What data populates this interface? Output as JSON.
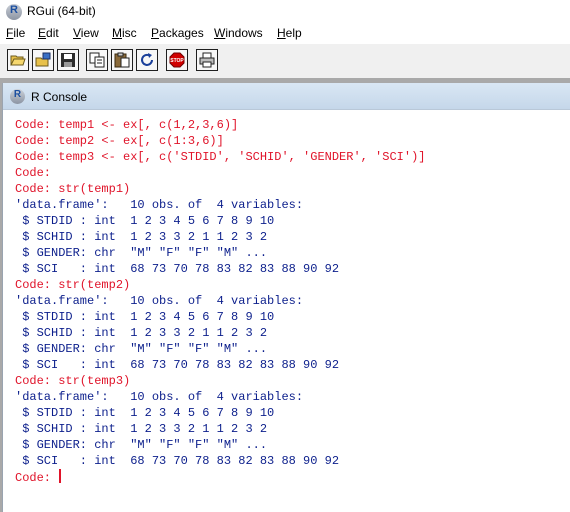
{
  "window": {
    "title": "RGui (64-bit)"
  },
  "menu": {
    "items": [
      {
        "underline": "F",
        "rest": "ile"
      },
      {
        "underline": "E",
        "rest": "dit"
      },
      {
        "underline": "V",
        "rest": "iew"
      },
      {
        "underline": "M",
        "rest": "isc"
      },
      {
        "underline": "P",
        "rest": "ackages"
      },
      {
        "underline": "W",
        "rest": "indows"
      },
      {
        "underline": "H",
        "rest": "elp"
      }
    ]
  },
  "toolbar": {
    "buttons": [
      {
        "icon": "open-folder-icon"
      },
      {
        "icon": "load-workspace-icon"
      },
      {
        "icon": "save-icon"
      },
      {
        "icon": "copy-icon"
      },
      {
        "icon": "paste-icon"
      },
      {
        "icon": "refresh-icon"
      },
      {
        "icon": "stop-icon",
        "label": "STOP",
        "color": "#d10000"
      },
      {
        "icon": "print-icon"
      }
    ]
  },
  "console": {
    "title": "R Console",
    "prompt": "Code: ",
    "lines": [
      {
        "type": "in",
        "text": "Code: temp1 <- ex[, c(1,2,3,6)]"
      },
      {
        "type": "in",
        "text": "Code: temp2 <- ex[, c(1:3,6)]"
      },
      {
        "type": "in",
        "text": "Code: temp3 <- ex[, c('STDID', 'SCHID', 'GENDER', 'SCI')]"
      },
      {
        "type": "in",
        "text": "Code:"
      },
      {
        "type": "in",
        "text": "Code: str(temp1)"
      },
      {
        "type": "out",
        "text": "'data.frame':   10 obs. of  4 variables:"
      },
      {
        "type": "out",
        "text": " $ STDID : int  1 2 3 4 5 6 7 8 9 10"
      },
      {
        "type": "out",
        "text": " $ SCHID : int  1 2 3 3 2 1 1 2 3 2"
      },
      {
        "type": "out",
        "text": " $ GENDER: chr  \"M\" \"F\" \"F\" \"M\" ..."
      },
      {
        "type": "out",
        "text": " $ SCI   : int  68 73 70 78 83 82 83 88 90 92"
      },
      {
        "type": "in",
        "text": "Code: str(temp2)"
      },
      {
        "type": "out",
        "text": "'data.frame':   10 obs. of  4 variables:"
      },
      {
        "type": "out",
        "text": " $ STDID : int  1 2 3 4 5 6 7 8 9 10"
      },
      {
        "type": "out",
        "text": " $ SCHID : int  1 2 3 3 2 1 1 2 3 2"
      },
      {
        "type": "out",
        "text": " $ GENDER: chr  \"M\" \"F\" \"F\" \"M\" ..."
      },
      {
        "type": "out",
        "text": " $ SCI   : int  68 73 70 78 83 82 83 88 90 92"
      },
      {
        "type": "in",
        "text": "Code: str(temp3)"
      },
      {
        "type": "out",
        "text": "'data.frame':   10 obs. of  4 variables:"
      },
      {
        "type": "out",
        "text": " $ STDID : int  1 2 3 4 5 6 7 8 9 10"
      },
      {
        "type": "out",
        "text": " $ SCHID : int  1 2 3 3 2 1 1 2 3 2"
      },
      {
        "type": "out",
        "text": " $ GENDER: chr  \"M\" \"F\" \"F\" \"M\" ..."
      },
      {
        "type": "out",
        "text": " $ SCI   : int  68 73 70 78 83 82 83 88 90 92"
      }
    ]
  },
  "colors": {
    "input": "#e0142a",
    "output": "#0c1f8c",
    "header": "#d9e7f4",
    "mdi_background": "#a9a9a9"
  }
}
